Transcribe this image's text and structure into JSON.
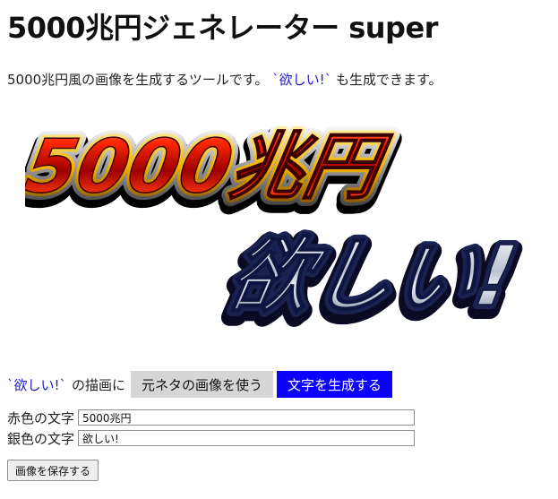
{
  "page": {
    "title": "5000兆円ジェネレーター super",
    "description_prefix": "5000兆円風の画像を生成するツールです。",
    "description_code": "`欲しい!`",
    "description_suffix": "も生成できます。"
  },
  "logo": {
    "red_text": "5000兆円",
    "silver_text": "欲しい!"
  },
  "controls": {
    "code_label": "`欲しい!`",
    "render_label": "の描画に",
    "use_original_button": "元ネタの画像を使う",
    "generate_text_button": "文字を生成する"
  },
  "fields": {
    "red_label": "赤色の文字",
    "red_value": "5000兆円",
    "silver_label": "銀色の文字",
    "silver_value": "欲しい!"
  },
  "actions": {
    "save_button": "画像を保存する"
  },
  "colors": {
    "code_blue": "#1a1acc",
    "generate_button_bg": "#0b00ff",
    "original_button_bg": "#d6d6d6"
  }
}
